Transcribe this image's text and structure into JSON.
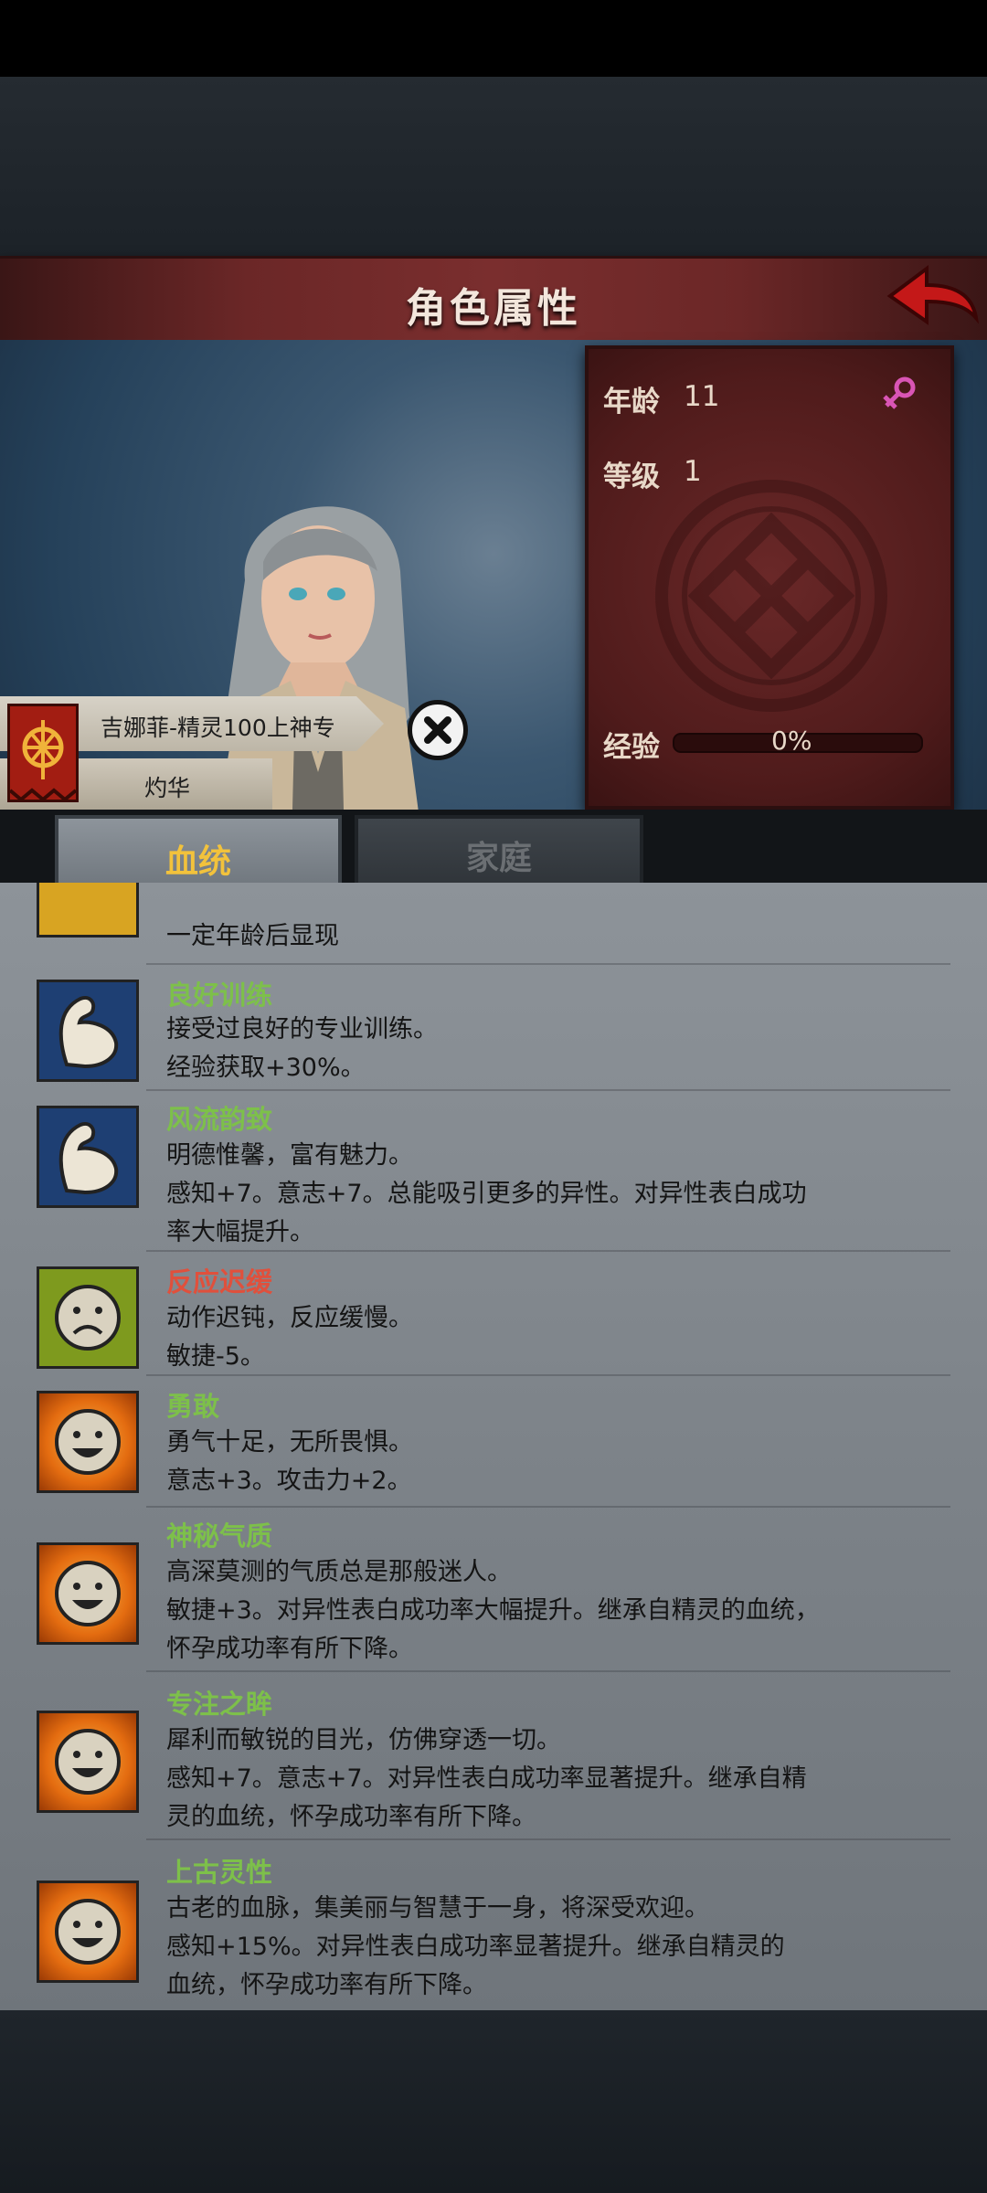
{
  "header": {
    "title": "角色属性"
  },
  "stats": {
    "age_label": "年龄",
    "age_value": "11",
    "level_label": "等级",
    "level_value": "1",
    "exp_label": "经验",
    "exp_value": "0%",
    "exp_fraction": 0
  },
  "character": {
    "name": "吉娜菲-精灵100上神专",
    "title": "灼华"
  },
  "tabs": [
    {
      "label": "血统",
      "active": true
    },
    {
      "label": "家庭",
      "active": false
    }
  ],
  "traits": [
    {
      "name": "",
      "lines": [
        "一定年龄后显现"
      ],
      "icon": "lock-icon"
    },
    {
      "name": "良好训练",
      "name_color": "#7dc04a",
      "icon": "arm-icon",
      "lines": [
        "接受过良好的专业训练。",
        "经验获取+30%。"
      ]
    },
    {
      "name": "风流韵致",
      "name_color": "#7dc04a",
      "icon": "arm-icon",
      "lines": [
        "明德惟馨，富有魅力。",
        "感知+7。意志+7。总能吸引更多的异性。对异性表白成功",
        "率大幅提升。"
      ]
    },
    {
      "name": "反应迟缓",
      "name_color": "#e0503c",
      "icon": "sad-face-icon",
      "lines": [
        "动作迟钝，反应缓慢。",
        "敏捷-5。"
      ]
    },
    {
      "name": "勇敢",
      "name_color": "#7dc04a",
      "icon": "happy-face-icon",
      "lines": [
        "勇气十足，无所畏惧。",
        "意志+3。攻击力+2。"
      ]
    },
    {
      "name": "神秘气质",
      "name_color": "#7dc04a",
      "icon": "happy-face-icon",
      "lines": [
        "高深莫测的气质总是那般迷人。",
        "敏捷+3。对异性表白成功率大幅提升。继承自精灵的血统，",
        "怀孕成功率有所下降。"
      ]
    },
    {
      "name": "专注之眸",
      "name_color": "#7dc04a",
      "icon": "happy-face-icon",
      "lines": [
        "犀利而敏锐的目光，仿佛穿透一切。",
        "感知+7。意志+7。对异性表白成功率显著提升。继承自精",
        "灵的血统，怀孕成功率有所下降。"
      ]
    },
    {
      "name": "上古灵性",
      "name_color": "#7dc04a",
      "icon": "happy-face-icon",
      "lines": [
        "古老的血脉，集美丽与智慧于一身，将深受欢迎。",
        "感知+15%。对异性表白成功率显著提升。继承自精灵的",
        "血统，怀孕成功率有所下降。"
      ]
    }
  ]
}
